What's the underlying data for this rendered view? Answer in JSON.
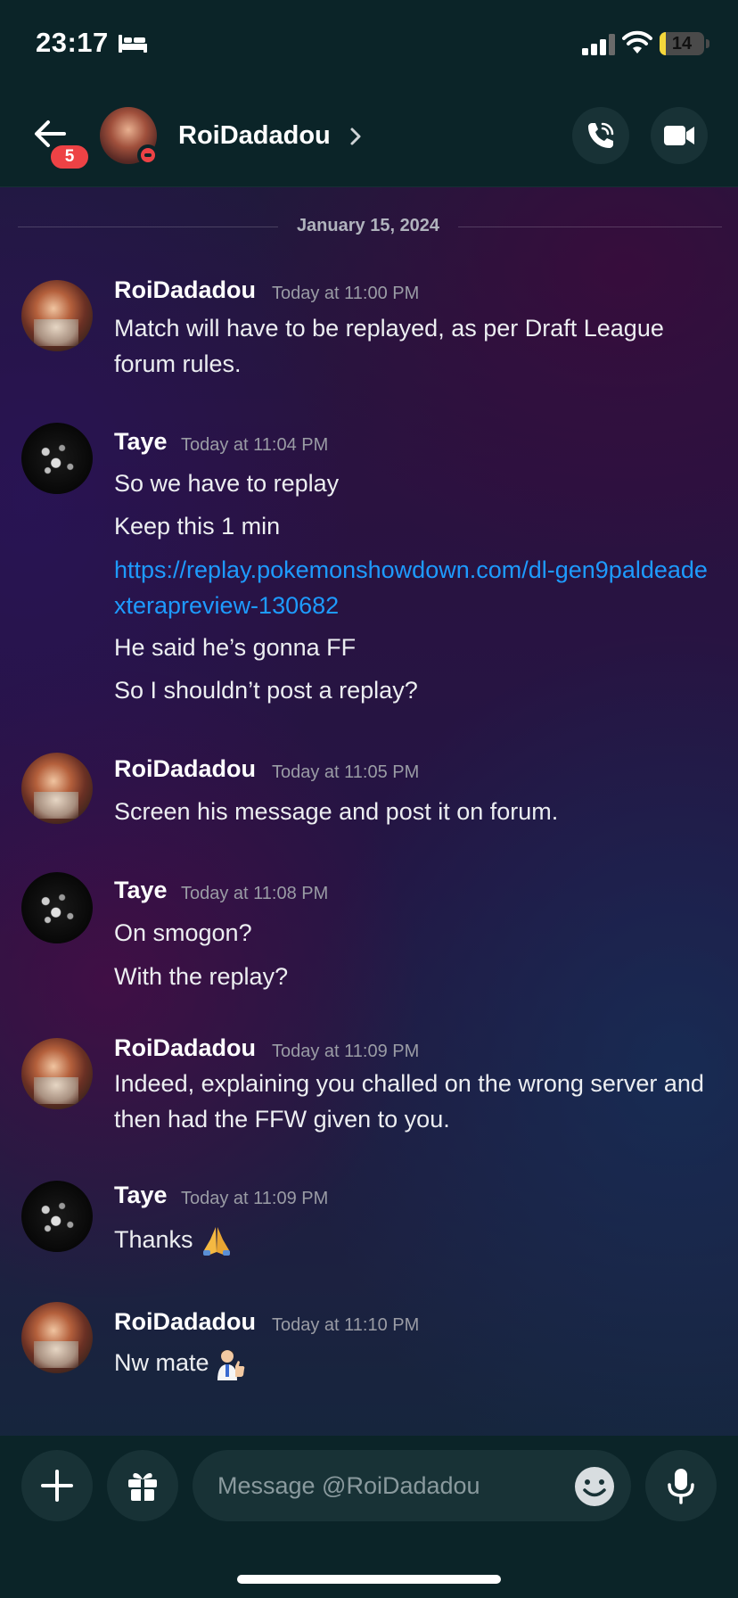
{
  "status_bar": {
    "time": "23:17",
    "battery": "14",
    "battery_level": 0.14
  },
  "header": {
    "back_badge": "5",
    "contact_name": "RoiDadadou"
  },
  "date_divider": "January 15, 2024",
  "messages": [
    {
      "author": "RoiDadadou",
      "time": "Today at 11:00 PM",
      "lines": [
        "Match will have to be replayed, as per Draft League forum rules."
      ]
    },
    {
      "author": "Taye",
      "time": "Today at 11:04 PM",
      "lines": [
        "So we have to replay",
        "Keep this 1 min",
        "https://replay.pokemonshowdown.com/dl-gen9paldeadexterapreview-130682",
        "He said he’s gonna FF",
        "So I shouldn’t post a replay?"
      ]
    },
    {
      "author": "RoiDadadou",
      "time": "Today at 11:05 PM",
      "lines": [
        "Screen his message and post it on forum."
      ]
    },
    {
      "author": "Taye",
      "time": "Today at 11:08 PM",
      "lines": [
        "On smogon?",
        "With the replay?"
      ]
    },
    {
      "author": "RoiDadadou",
      "time": "Today at 11:09 PM",
      "lines": [
        "Indeed, explaining you challed on the wrong server and then had the FFW given to you."
      ]
    },
    {
      "author": "Taye",
      "time": "Today at 11:09 PM",
      "lines": [
        "Thanks"
      ]
    },
    {
      "author": "RoiDadadou",
      "time": "Today at 11:10 PM",
      "lines": [
        "Nw mate"
      ]
    }
  ],
  "composer": {
    "placeholder": "Message @RoiDadadou"
  },
  "icons": {
    "bed": "bed-icon",
    "signal": "cellular-signal-icon",
    "wifi": "wifi-icon",
    "back": "back-arrow-icon",
    "chevron": "chevron-right-icon",
    "call": "phone-call-icon",
    "video": "video-camera-icon",
    "plus": "plus-icon",
    "gift": "gift-icon",
    "emoji": "emoji-smile-icon",
    "mic": "microphone-icon",
    "pray_emoji": "folded-hands-emoji",
    "thumbs_emoji": "thumbs-up-person-emoji"
  },
  "colors": {
    "link": "#1e9bff",
    "badge": "#ed4245",
    "header_bg": "#0b2428",
    "battery": "#f5d73b"
  }
}
